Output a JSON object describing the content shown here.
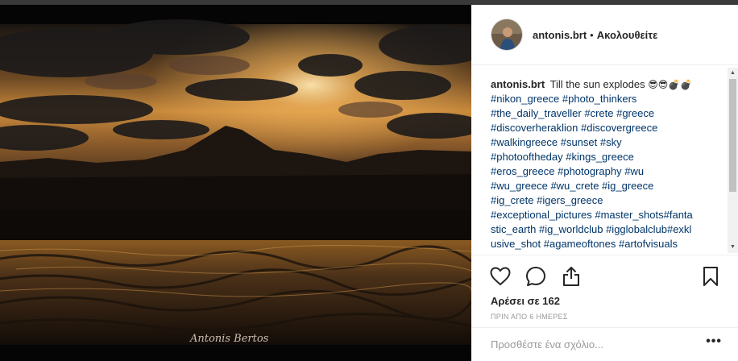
{
  "post": {
    "username": "antonis.brt",
    "separator": "•",
    "follow_label": "Ακολουθείτε",
    "caption_user": "antonis.brt",
    "caption_text": "Till the sun explodes",
    "caption_emoji": "😎😎💣💣",
    "hashtag_lines": [
      "#nikon_greece #photo_thinkers",
      "#the_daily_traveller #crete #greece",
      "#discoverheraklion #discovergreece",
      "#walkingreece #sunset #sky",
      "#photooftheday #kings_greece",
      "#eros_greece #photography #wu",
      "#wu_greece #wu_crete #ig_greece",
      "#ig_crete #igers_greece",
      "#exceptional_pictures #master_shots#fanta",
      "stic_earth #ig_worldclub #igglobalclub#exkl",
      "usive_shot #agameoftones  #artofvisuals"
    ],
    "likes": "Αρέσει σε 162",
    "time_ago": "ΠΡΙΝ ΑΠΟ 6 ΗΜΕΡΕΣ",
    "comment_placeholder": "Προσθέστε ένα σχόλιο...",
    "more_label": "•••",
    "watermark": "Antonis Bertos",
    "scroll_up": "▲",
    "scroll_down": "▼"
  },
  "icons": {
    "like": "heart-icon",
    "comment": "comment-bubble-icon",
    "share": "share-icon",
    "save": "bookmark-icon"
  },
  "colors": {
    "hashtag": "#003569",
    "text": "#262626",
    "muted": "#999999",
    "divider": "#efefef",
    "sky_glow": "#f2b35a"
  }
}
